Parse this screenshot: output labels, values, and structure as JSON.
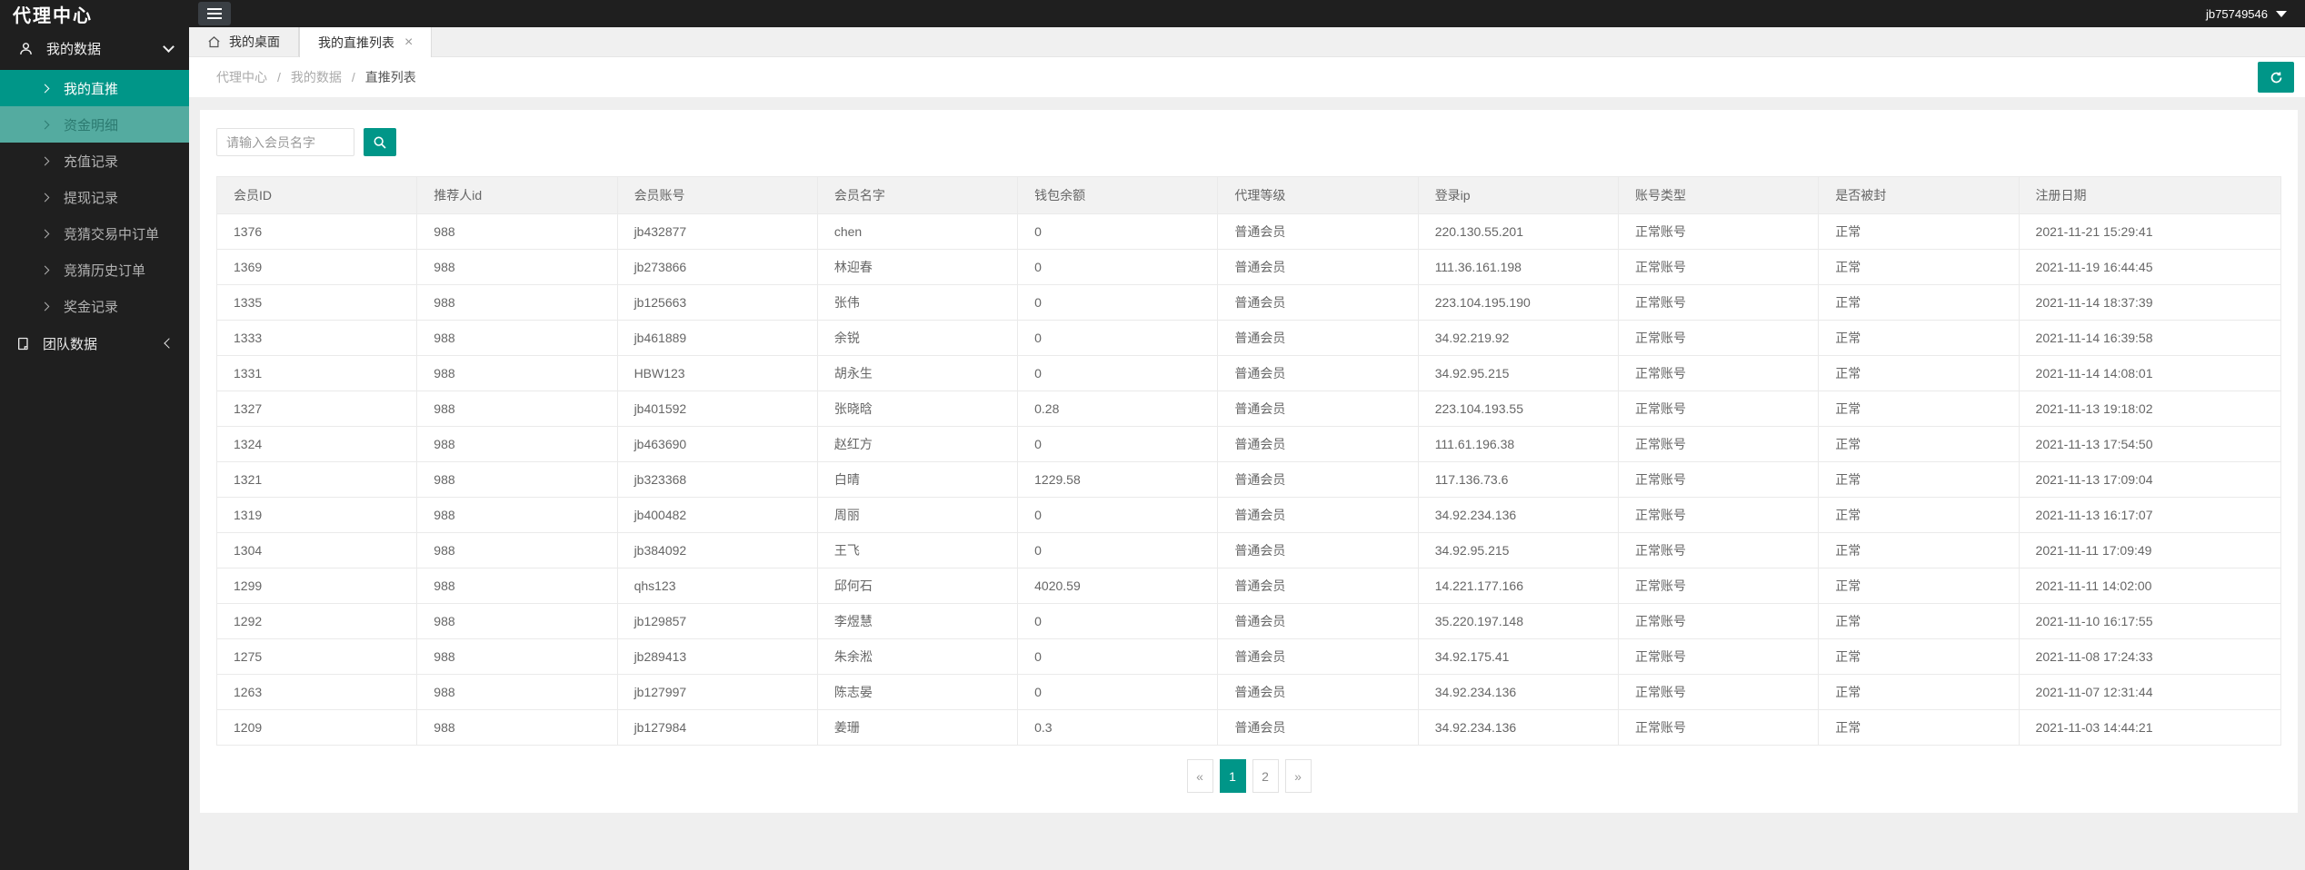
{
  "colors": {
    "accent": "#009688",
    "accent_light": "#54aba0",
    "header_bg": "#1f1f1f"
  },
  "header": {
    "title": "代理中心",
    "username": "jb75749546"
  },
  "sidebar": {
    "groups": [
      {
        "label": "我的数据",
        "icon": "user-icon",
        "items": [
          {
            "label": "我的直推",
            "active": true
          },
          {
            "label": "资金明细",
            "highlighted": true
          },
          {
            "label": "充值记录"
          },
          {
            "label": "提现记录"
          },
          {
            "label": "竞猜交易中订单"
          },
          {
            "label": "竞猜历史订单"
          },
          {
            "label": "奖金记录"
          }
        ]
      },
      {
        "label": "团队数据",
        "icon": "document-icon",
        "items": []
      }
    ]
  },
  "tabs": [
    {
      "label": "我的桌面",
      "icon": "home-icon",
      "active": false
    },
    {
      "label": "我的直推列表",
      "active": true,
      "close_label": "×"
    }
  ],
  "breadcrumb": {
    "items": [
      "代理中心",
      "我的数据",
      "直推列表"
    ],
    "separator": "/"
  },
  "search": {
    "placeholder": "请输入会员名字"
  },
  "table": {
    "columns": [
      "会员ID",
      "推荐人id",
      "会员账号",
      "会员名字",
      "钱包余额",
      "代理等级",
      "登录ip",
      "账号类型",
      "是否被封",
      "注册日期"
    ],
    "rows": [
      [
        "1376",
        "988",
        "jb432877",
        "chen",
        "0",
        "普通会员",
        "220.130.55.201",
        "正常账号",
        "正常",
        "2021-11-21 15:29:41"
      ],
      [
        "1369",
        "988",
        "jb273866",
        "林迎春",
        "0",
        "普通会员",
        "111.36.161.198",
        "正常账号",
        "正常",
        "2021-11-19 16:44:45"
      ],
      [
        "1335",
        "988",
        "jb125663",
        "张伟",
        "0",
        "普通会员",
        "223.104.195.190",
        "正常账号",
        "正常",
        "2021-11-14 18:37:39"
      ],
      [
        "1333",
        "988",
        "jb461889",
        "余锐",
        "0",
        "普通会员",
        "34.92.219.92",
        "正常账号",
        "正常",
        "2021-11-14 16:39:58"
      ],
      [
        "1331",
        "988",
        "HBW123",
        "胡永生",
        "0",
        "普通会员",
        "34.92.95.215",
        "正常账号",
        "正常",
        "2021-11-14 14:08:01"
      ],
      [
        "1327",
        "988",
        "jb401592",
        "张晓晗",
        "0.28",
        "普通会员",
        "223.104.193.55",
        "正常账号",
        "正常",
        "2021-11-13 19:18:02"
      ],
      [
        "1324",
        "988",
        "jb463690",
        "赵红方",
        "0",
        "普通会员",
        "111.61.196.38",
        "正常账号",
        "正常",
        "2021-11-13 17:54:50"
      ],
      [
        "1321",
        "988",
        "jb323368",
        "白晴",
        "1229.58",
        "普通会员",
        "117.136.73.6",
        "正常账号",
        "正常",
        "2021-11-13 17:09:04"
      ],
      [
        "1319",
        "988",
        "jb400482",
        "周丽",
        "0",
        "普通会员",
        "34.92.234.136",
        "正常账号",
        "正常",
        "2021-11-13 16:17:07"
      ],
      [
        "1304",
        "988",
        "jb384092",
        "王飞",
        "0",
        "普通会员",
        "34.92.95.215",
        "正常账号",
        "正常",
        "2021-11-11 17:09:49"
      ],
      [
        "1299",
        "988",
        "qhs123",
        "邱何石",
        "4020.59",
        "普通会员",
        "14.221.177.166",
        "正常账号",
        "正常",
        "2021-11-11 14:02:00"
      ],
      [
        "1292",
        "988",
        "jb129857",
        "李煜慧",
        "0",
        "普通会员",
        "35.220.197.148",
        "正常账号",
        "正常",
        "2021-11-10 16:17:55"
      ],
      [
        "1275",
        "988",
        "jb289413",
        "朱余淞",
        "0",
        "普通会员",
        "34.92.175.41",
        "正常账号",
        "正常",
        "2021-11-08 17:24:33"
      ],
      [
        "1263",
        "988",
        "jb127997",
        "陈志晏",
        "0",
        "普通会员",
        "34.92.234.136",
        "正常账号",
        "正常",
        "2021-11-07 12:31:44"
      ],
      [
        "1209",
        "988",
        "jb127984",
        "姜珊",
        "0.3",
        "普通会员",
        "34.92.234.136",
        "正常账号",
        "正常",
        "2021-11-03 14:44:21"
      ]
    ]
  },
  "pagination": {
    "prev": "«",
    "pages": [
      "1",
      "2"
    ],
    "active_page": "1",
    "next": "»"
  }
}
